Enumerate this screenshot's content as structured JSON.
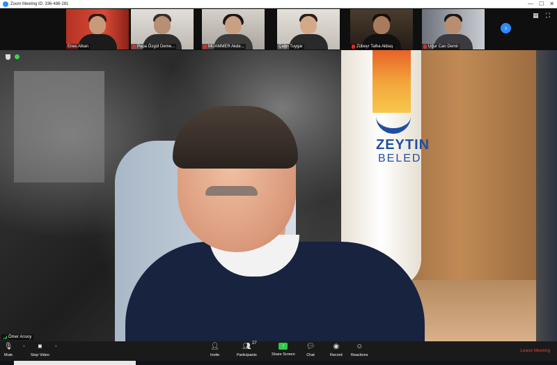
{
  "titlebar": {
    "title": "Zoom Meeting ID: 336-488-281",
    "minimize": "—",
    "maximize": "☐",
    "close": "✕"
  },
  "thumbnails": [
    {
      "name": "Enes Alkan",
      "muted": false,
      "bg": "#c23a2a"
    },
    {
      "name": "Papa Özgül Deme...",
      "muted": true,
      "bg": "#d8d4cf"
    },
    {
      "name": "MUAMMER Akde...",
      "muted": true,
      "bg": "#cfcac2"
    },
    {
      "name": "Çağrı Tuygar",
      "muted": false,
      "bg": "#d9d5cf"
    },
    {
      "name": "Zübeyr Talha Akbaş",
      "muted": true,
      "bg": "#3a3028"
    },
    {
      "name": "Uğur Can Demir",
      "muted": true,
      "bg": "#8a8e96"
    }
  ],
  "strip": {
    "next_icon": "›"
  },
  "main": {
    "speaker_name": "Ömer Arısoy",
    "flag_text_1": "ZEYTIN",
    "flag_text_2": "BELED"
  },
  "toolbar": {
    "mute_label": "Mute",
    "video_label": "Stop Video",
    "invite_label": "Invite",
    "participants_label": "Participants",
    "participants_count": "27",
    "share_label": "Share Screen",
    "chat_label": "Chat",
    "record_label": "Record",
    "reactions_label": "Reactions",
    "leave_label": "Leave Meeting",
    "caret": "^"
  }
}
